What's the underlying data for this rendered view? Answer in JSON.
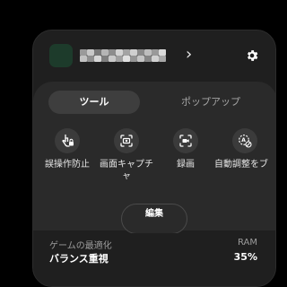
{
  "header": {
    "avatar_color": "#1d3b2b",
    "name_redacted": true,
    "chevron": "›",
    "settings_icon": "gear-icon"
  },
  "tabs": [
    {
      "label": "ツール",
      "active": true
    },
    {
      "label": "ポップアップ",
      "active": false
    }
  ],
  "tools": [
    {
      "label": "誤操作防止",
      "icon": "touch-lock-icon"
    },
    {
      "label": "画面キャプチャ",
      "icon": "screen-capture-icon"
    },
    {
      "label": "録画",
      "icon": "screen-record-icon"
    },
    {
      "label": "自動調整をブ",
      "icon": "auto-adjust-block-icon"
    }
  ],
  "edit_label": "編集",
  "footer": {
    "optimization_label": "ゲームの最適化",
    "optimization_value": "バランス重視",
    "ram_label": "RAM",
    "ram_value": "35%"
  },
  "colors": {
    "background": "#000000",
    "card": "#1f1f1f",
    "panel": "#2a2a2a",
    "active_tab": "#3e3e3e"
  }
}
